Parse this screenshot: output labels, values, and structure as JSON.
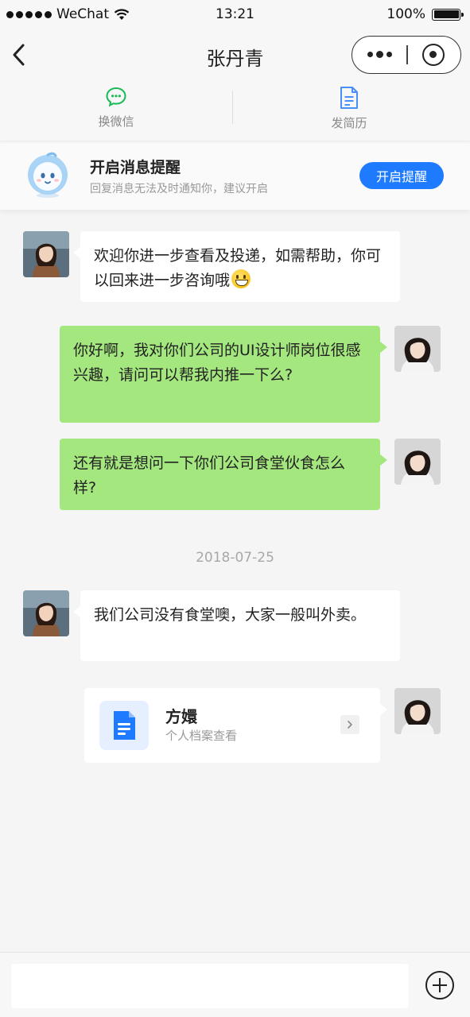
{
  "status_bar": {
    "carrier": "WeChat",
    "time": "13:21",
    "battery_text": "100%",
    "battery_level": 1.0
  },
  "nav": {
    "title": "张丹青"
  },
  "actions": {
    "wechat_label": "换微信",
    "resume_label": "发简历"
  },
  "reminder": {
    "title": "开启消息提醒",
    "subtitle": "回复消息无法及时通知你，建议开启",
    "button_label": "开启提醒"
  },
  "messages": [
    {
      "side": "in",
      "text": "欢迎你进一步查看及投递，如需帮助，你可以回来进一步咨询哦",
      "emoji": "grinning-face-emoji"
    },
    {
      "side": "out",
      "text": "你好啊，我对你们公司的UI设计师岗位很感兴趣，请问可以帮我内推一下么?"
    },
    {
      "side": "out",
      "text": "还有就是想问一下你们公司食堂伙食怎么样?"
    },
    {
      "side": "in",
      "text": "我们公司没有食堂噢，大家一般叫外卖。"
    }
  ],
  "date_separator": "2018-07-25",
  "file_card": {
    "name": "方嬛",
    "subtitle": "个人档案查看",
    "icon": "document-icon"
  },
  "input": {
    "placeholder": ""
  },
  "colors": {
    "accent": "#1e7bff",
    "outgoing_bubble": "#a4e77f",
    "incoming_bubble": "#ffffff",
    "wechat_green": "#19b955",
    "background": "#f5f5f5"
  }
}
